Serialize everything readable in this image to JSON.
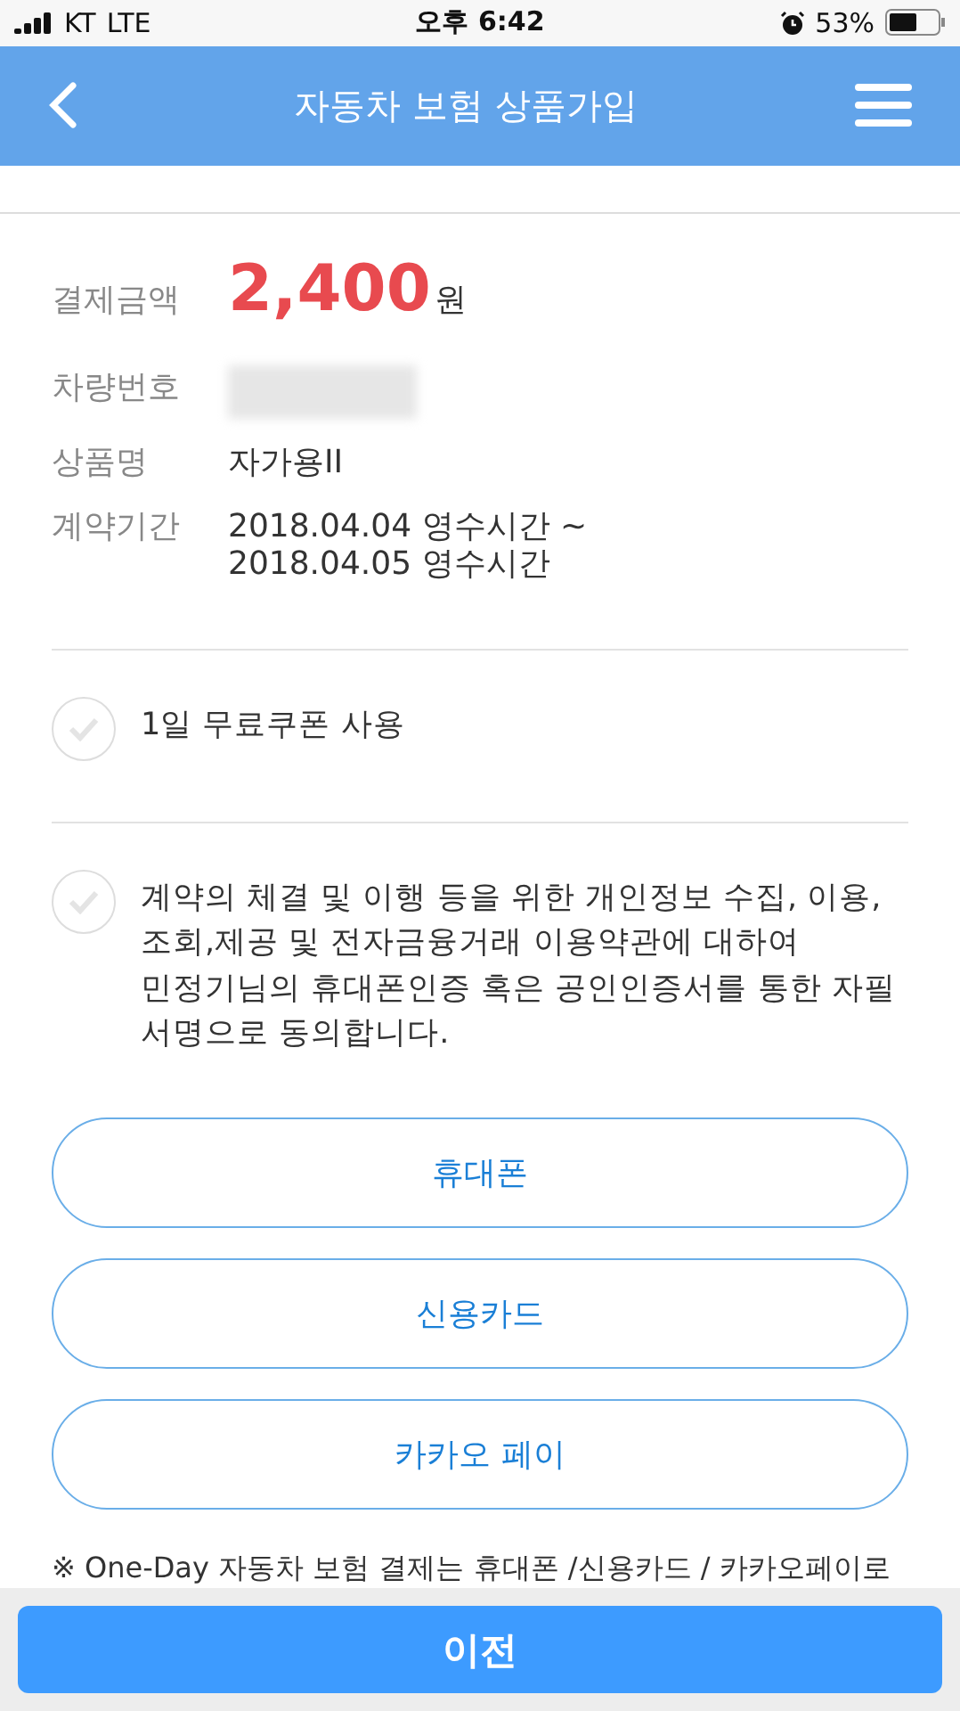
{
  "status_bar": {
    "carrier": "KT",
    "network": "LTE",
    "time": "오후 6:42",
    "battery": "53%"
  },
  "header": {
    "title": "자동차 보험 상품가입"
  },
  "details": [
    {
      "kind": "amount",
      "label": "결제금액",
      "value": "2,400",
      "unit": "원"
    },
    {
      "kind": "redacted",
      "label": "차량번호"
    },
    {
      "kind": "text",
      "label": "상품명",
      "value": "자가용II"
    },
    {
      "kind": "period",
      "label": "계약기간",
      "lines": [
        "2018.04.04 영수시간 ~",
        "2018.04.05 영수시간"
      ]
    }
  ],
  "options": [
    {
      "label": "1일 무료쿠폰 사용",
      "checked": false
    },
    {
      "label": "계약의 체결 및 이행 등을 위한 개인정보 수집, 이용, 조회,제공 및 전자금융거래 이용약관에 대하여 민정기님의 휴대폰인증 혹은 공인인증서를 통한 자필 서명으로 동의합니다.",
      "checked": false
    }
  ],
  "payment_buttons": [
    "휴대폰",
    "신용카드",
    "카카오 페이"
  ],
  "note": "※ One-Day 자동차 보험 결제는 휴대폰 /신용카드 / 카카오페이로",
  "footer_button": "이전"
}
